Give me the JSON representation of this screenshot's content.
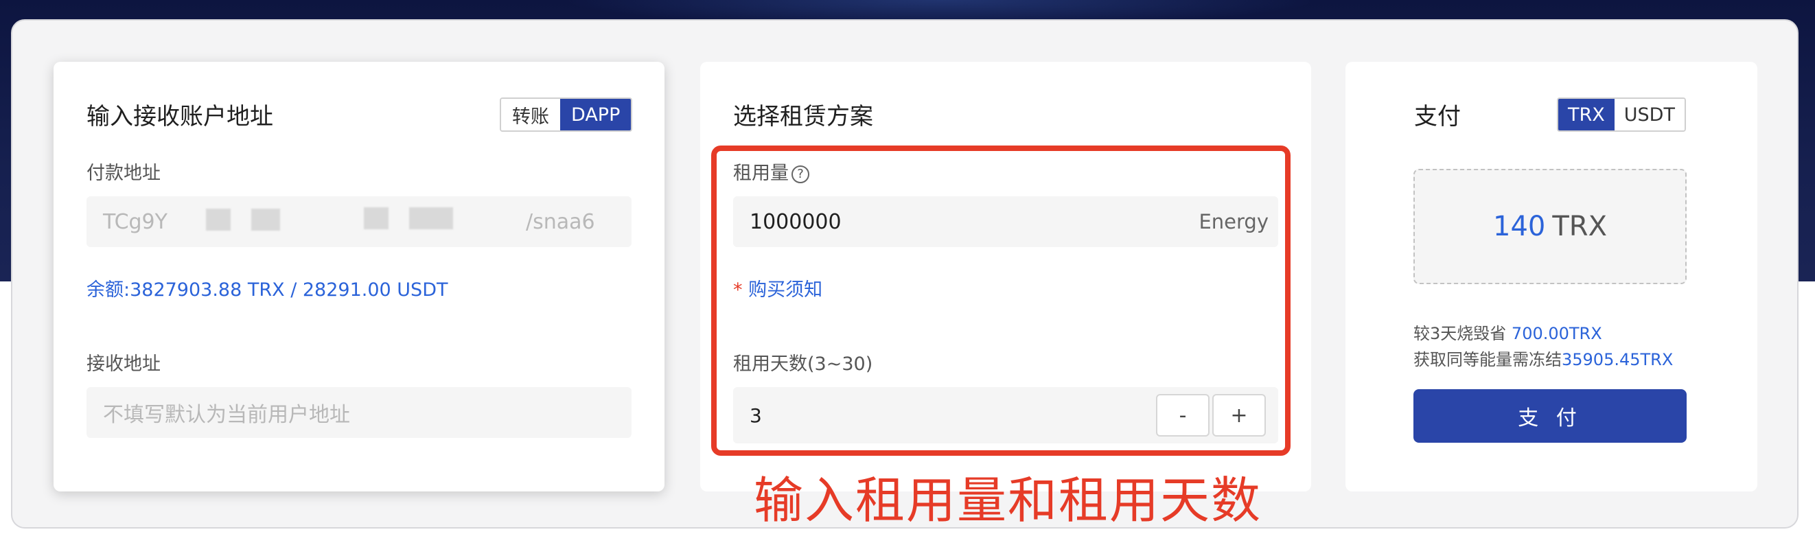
{
  "colors": {
    "accent": "#2a45a8",
    "link": "#2b63d9",
    "annotation": "#e63b27",
    "hero_bg": "#16204f"
  },
  "account": {
    "title": "输入接收账户地址",
    "toggle": [
      "转账",
      "DAPP"
    ],
    "toggle_selected": "DAPP",
    "payer_label": "付款地址",
    "payer_value_start": "TCg9Y",
    "payer_value_end": "/snaa6",
    "balance": "余额:3827903.88 TRX / 28291.00 USDT",
    "receiver_label": "接收地址",
    "receiver_placeholder": "不填写默认为当前用户地址"
  },
  "plan": {
    "title": "选择租赁方案",
    "amount_label": "租用量",
    "help_icon": "?",
    "amount_value": "1000000",
    "amount_unit": "Energy",
    "notice_star": "*",
    "notice_link": "购买须知",
    "days_label": "租用天数(3~30)",
    "days_value": "3",
    "minus": "-",
    "plus": "+",
    "annotation": "输入租用量和租用天数"
  },
  "pay": {
    "title": "支付",
    "currency_toggle": [
      "TRX",
      "USDT"
    ],
    "currency_selected": "TRX",
    "amount_number": "140",
    "amount_unit": "TRX",
    "save_prefix": "较3天烧毁省",
    "save_value": "700.00TRX",
    "freeze_prefix": "获取同等能量需冻结",
    "freeze_value": "35905.45TRX",
    "button": "支 付"
  }
}
